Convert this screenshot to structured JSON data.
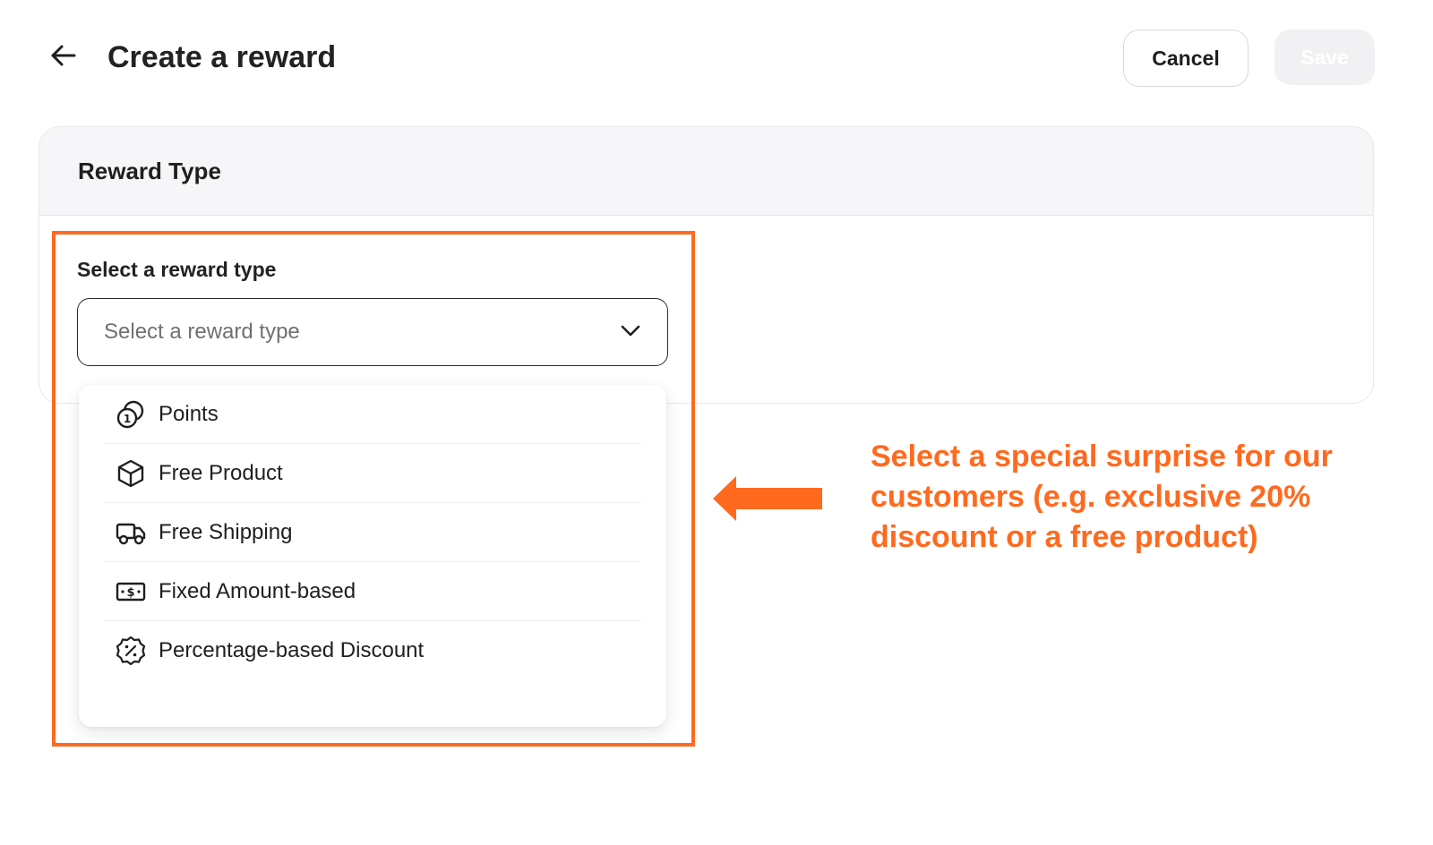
{
  "header": {
    "title": "Create a reward",
    "back_icon": "arrow-left-icon",
    "cancel_label": "Cancel",
    "save_label": "Save"
  },
  "card": {
    "title": "Reward Type"
  },
  "reward_type_field": {
    "label": "Select a reward type",
    "placeholder": "Select a reward type",
    "icon": "chevron-down-icon",
    "options": [
      {
        "label": "Points",
        "icon": "coins-icon"
      },
      {
        "label": "Free Product",
        "icon": "box-icon"
      },
      {
        "label": "Free Shipping",
        "icon": "truck-icon"
      },
      {
        "label": "Fixed Amount-based",
        "icon": "cash-icon"
      },
      {
        "label": "Percentage-based Discount",
        "icon": "percent-badge-icon"
      }
    ]
  },
  "annotation": {
    "text": "Select a special surprise for our customers (e.g. exclusive 20% discount or a free product)",
    "color": "#ff6a1f"
  },
  "colors": {
    "accent": "#ff6a1f",
    "save_disabled_bg": "#f1f1f3",
    "card_header_bg": "#f6f6f8"
  }
}
